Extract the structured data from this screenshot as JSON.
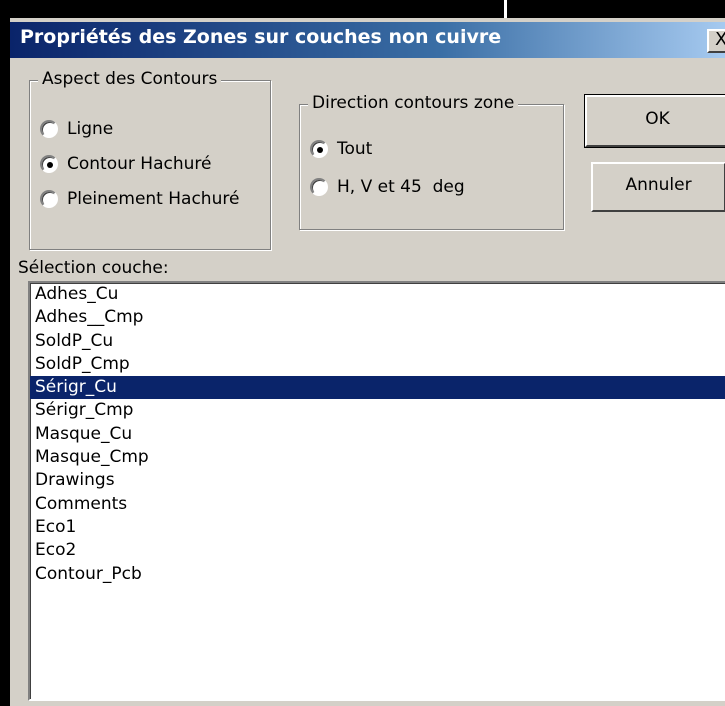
{
  "window": {
    "title": "Propriétés des Zones sur couches non cuivre",
    "close_glyph": "X"
  },
  "aspect_group": {
    "legend": "Aspect des Contours",
    "options": [
      {
        "label": "Ligne",
        "selected": false
      },
      {
        "label": "Contour Hachuré",
        "selected": true
      },
      {
        "label": "Pleinement Hachuré",
        "selected": false
      }
    ]
  },
  "direction_group": {
    "legend": "Direction contours zone",
    "options": [
      {
        "label": "Tout",
        "selected": true
      },
      {
        "label": "H, V et 45  deg",
        "selected": false
      }
    ]
  },
  "buttons": {
    "ok": "OK",
    "cancel": "Annuler"
  },
  "layer_list": {
    "label": "Sélection couche:",
    "selected_index": 4,
    "items": [
      "Adhes_Cu",
      "Adhes__Cmp",
      "SoldP_Cu",
      "SoldP_Cmp",
      "Sérigr_Cu",
      "Sérigr_Cmp",
      "Masque_Cu",
      "Masque_Cmp",
      "Drawings",
      "Comments",
      "Eco1",
      "Eco2",
      "Contour_Pcb"
    ]
  },
  "colors": {
    "title_bar": "#0a246a",
    "selection": "#0a246a",
    "dialog_face": "#d4d0c8"
  }
}
